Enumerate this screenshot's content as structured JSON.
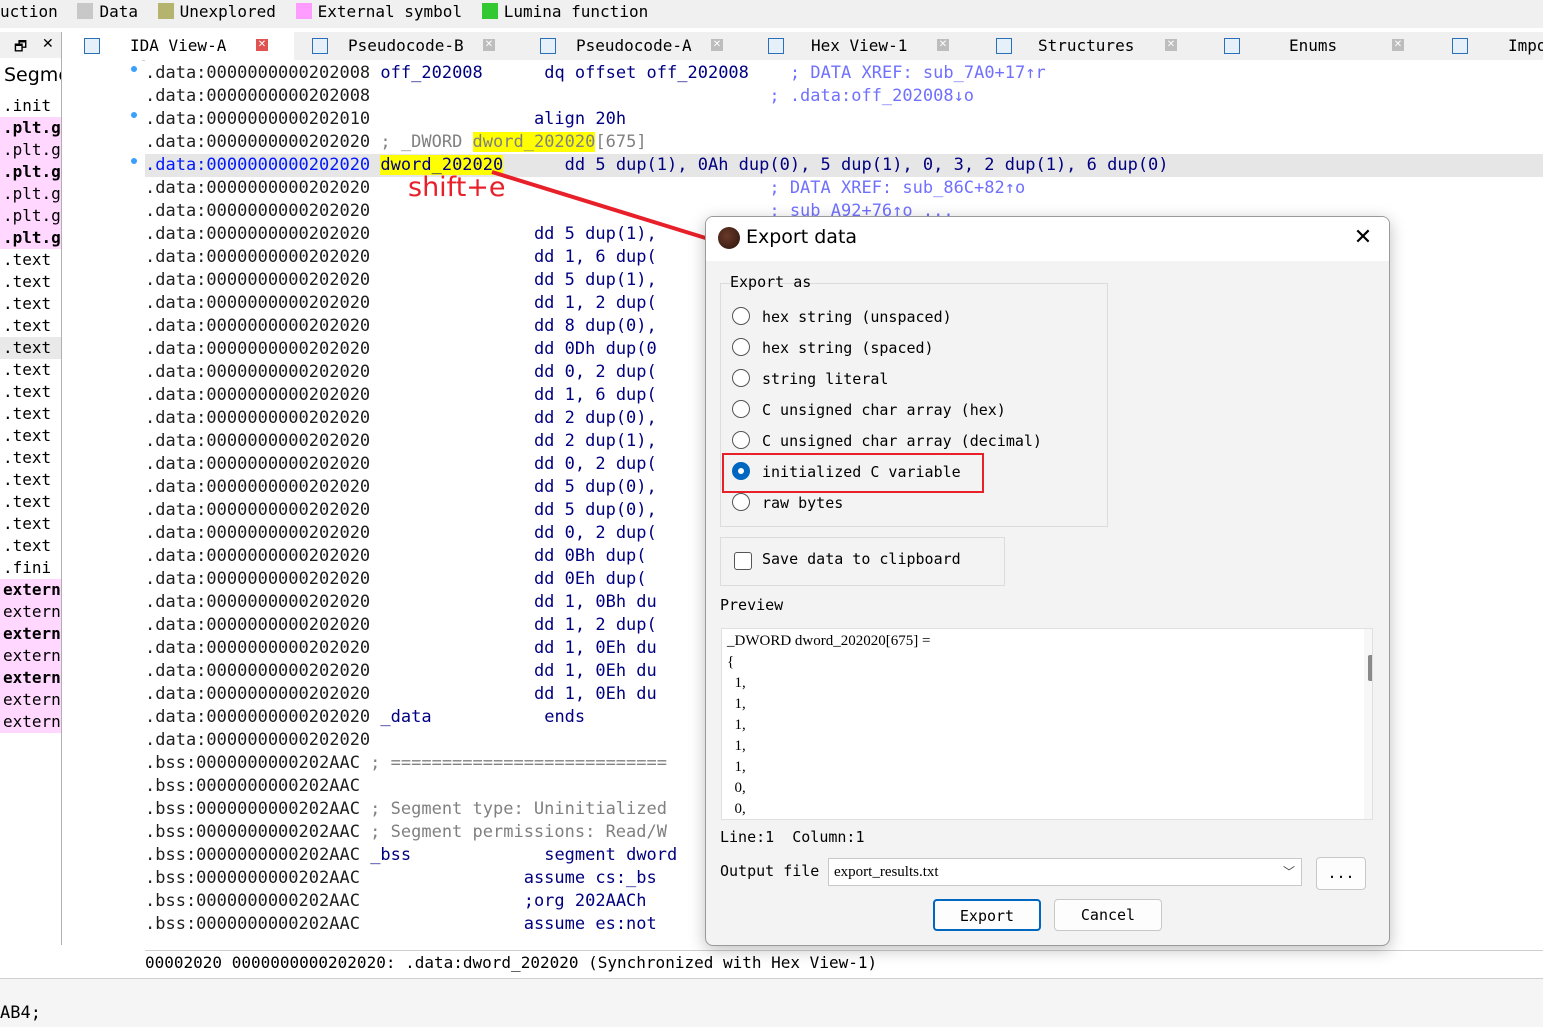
{
  "legend": [
    {
      "label": "uction",
      "color": ""
    },
    {
      "label": "Data",
      "color": "#c8c8c8"
    },
    {
      "label": "Unexplored",
      "color": "#b4b46e"
    },
    {
      "label": "External symbol",
      "color": "#ff9cff"
    },
    {
      "label": "Lumina function",
      "color": "#32c832"
    }
  ],
  "tabs": [
    {
      "label": "IDA View-A",
      "icon": "listing-icon"
    },
    {
      "label": "Pseudocode-B",
      "icon": "pseudocode-icon"
    },
    {
      "label": "Pseudocode-A",
      "icon": "pseudocode-icon"
    },
    {
      "label": "Hex View-1",
      "icon": "hex-icon"
    },
    {
      "label": "Structures",
      "icon": "structures-icon"
    },
    {
      "label": "Enums",
      "icon": "enums-icon"
    },
    {
      "label": "Impo",
      "icon": "imports-icon"
    }
  ],
  "segments": {
    "float_btn": "🗗",
    "close_btn": "✕",
    "title": "Segme",
    "rows": [
      ".init",
      ".plt.g",
      ".plt.gc",
      ".plt.g",
      ".plt.gc",
      ".plt.gc",
      ".plt.g",
      ".text",
      ".text",
      ".text",
      ".text",
      ".text",
      ".text",
      ".text",
      ".text",
      ".text",
      ".text",
      ".text",
      ".text",
      ".text",
      ".text",
      ".fini",
      "extern",
      "extern",
      "extern",
      "extern",
      "extern",
      "extern",
      "extern"
    ]
  },
  "listing": {
    "l0": {
      "addr": ".data:0000000000202008",
      "name": "off_202008",
      "ins": "dq offset off_202008",
      "cmt": "; DATA XREF: sub_7A0+17↑r"
    },
    "l1": {
      "addr": ".data:0000000000202008",
      "cmt": "; .data:off_202008↓o"
    },
    "l2": {
      "addr": ".data:0000000000202010",
      "ins": "align 20h"
    },
    "l3": {
      "addr": ".data:0000000000202020",
      "pre": "; _DWORD ",
      "name": "dword_202020",
      "suf": "[675]"
    },
    "l4": {
      "addr": ".data:0000000000202020",
      "name": "dword_202020",
      "ins": "dd 5 dup(1), 0Ah dup(0), 5 dup(1), 0, 3, 2 dup(1), 6 dup(0)"
    },
    "l5": {
      "addr": ".data:0000000000202020",
      "cmt": "; DATA XREF: sub_86C+82↑o"
    },
    "l6": {
      "addr": ".data:0000000000202020",
      "cmt": "; sub_A92+76↑o ..."
    },
    "dd_addr": ".data:0000000000202020",
    "dd": [
      "dd 5 dup(1),",
      "dd 1, 6 dup(",
      "dd 5 dup(1),",
      "dd 1, 2 dup(",
      "dd 8 dup(0),",
      "dd 0Dh dup(0",
      "dd 0, 2 dup(",
      "dd 1, 6 dup(",
      "dd 2 dup(0),",
      "dd 2 dup(1),",
      "dd 0, 2 dup(",
      "dd 5 dup(0),",
      "dd 5 dup(0),",
      "dd 0, 2 dup(",
      "dd 0Bh dup(",
      "dd 0Eh dup(",
      "dd 1, 0Bh du",
      "dd 1, 2 dup(",
      "dd 1, 0Eh du",
      "dd 1, 0Eh du",
      "dd 1, 0Eh du"
    ],
    "ends": {
      "addr": ".data:0000000000202020",
      "name": "_data",
      "ins": "ends"
    },
    "blank": {
      "addr": ".data:0000000000202020"
    },
    "bss": [
      {
        "addr": ".bss:0000000000202AAC",
        "rest": " ; ==========================="
      },
      {
        "addr": ".bss:0000000000202AAC",
        "rest": ""
      },
      {
        "addr": ".bss:0000000000202AAC",
        "rest": " ; Segment type: Uninitialized"
      },
      {
        "addr": ".bss:0000000000202AAC",
        "rest": " ; Segment permissions: Read/W"
      },
      {
        "addr": ".bss:0000000000202AAC",
        "name": "_bss",
        "ins": "segment dword"
      },
      {
        "addr": ".bss:0000000000202AAC",
        "ins": "assume cs:_bs"
      },
      {
        "addr": ".bss:0000000000202AAC",
        "ins": ";org 202AACh"
      },
      {
        "addr": ".bss:0000000000202AAC",
        "ins": "assume es:not"
      }
    ]
  },
  "annotation": "shift+e",
  "status": {
    "offset": "00002020",
    "text": "0000000000202020: .data:dword_202020",
    "sync": "(Synchronized with Hex View-1)"
  },
  "bottom_text": "AB4;",
  "dialog": {
    "title": "Export data",
    "close": "✕",
    "group_label": "Export as",
    "options": [
      "hex string (unspaced)",
      "hex string (spaced)",
      "string literal",
      "C unsigned char array (hex)",
      "C unsigned char array (decimal)",
      "initialized C variable",
      "raw bytes"
    ],
    "selected": 5,
    "clipboard_label": "Save data to clipboard",
    "preview_label": "Preview",
    "preview_lines": [
      "_DWORD dword_202020[675] =",
      "{",
      "  1,",
      "  1,",
      "  1,",
      "  1,",
      "  1,",
      "  0,",
      "  0,"
    ],
    "line_col": "Line:1  Column:1",
    "output_label": "Output file",
    "output_value": "export_results.txt",
    "browse": "...",
    "export_btn": "Export",
    "cancel_btn": "Cancel"
  }
}
